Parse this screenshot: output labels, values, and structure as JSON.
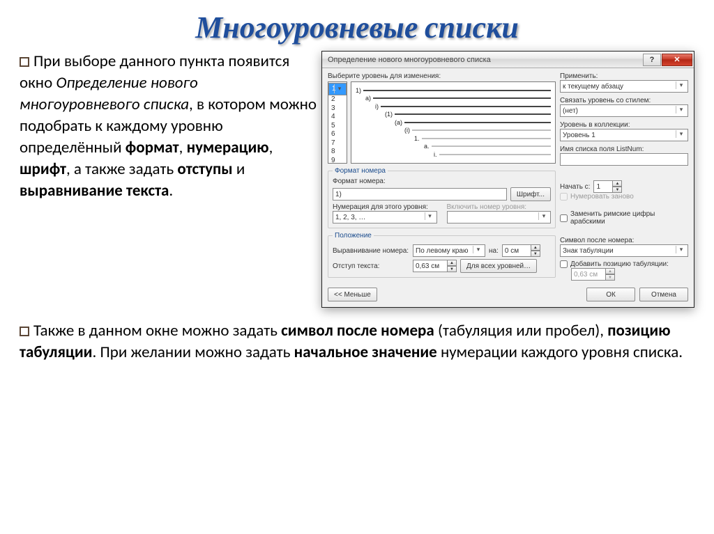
{
  "title": "Многоуровневые списки",
  "para1": {
    "p1": "При выборе данного пункта появится окно ",
    "i1": "Определение нового многоуровневого списка",
    "p2": ", в котором можно подобрать к каждому уровню определённый ",
    "b1": "формат",
    "c1": ", ",
    "b2": "нумерацию",
    "c2": ", ",
    "b3": "шрифт",
    "p3": ", а также задать ",
    "b4": "отступы",
    "p4": " и ",
    "b5": "выравнивание текста",
    "dot": "."
  },
  "para2": {
    "p1": "Также в данном окне можно задать ",
    "b1": "символ после номера",
    "p2": " (табуляция или пробел), ",
    "b2": "позицию табуляции",
    "p3": ". При желании можно  задать ",
    "b3": "начальное значение",
    "p4": " нумерации каждого уровня списка."
  },
  "dialog": {
    "title": "Определение нового многоуровневого списка",
    "select_level_label": "Выберите уровень для изменения:",
    "levels": [
      "1",
      "2",
      "3",
      "4",
      "5",
      "6",
      "7",
      "8",
      "9"
    ],
    "preview_numbers": [
      "1)",
      "a)",
      "i)",
      "(1)",
      "(a)",
      "(i)",
      "1.",
      "a.",
      "i."
    ],
    "format_group": "Формат номера",
    "format_label": "Формат номера:",
    "format_value": "1)",
    "font_btn": "Шрифт...",
    "numbering_label": "Нумерация для этого уровня:",
    "numbering_value": "1, 2, 3, …",
    "include_label": "Включить номер уровня:",
    "position_group": "Положение",
    "align_label": "Выравнивание номера:",
    "align_value": "По левому краю",
    "at_label": "на:",
    "at_value": "0 см",
    "indent_label": "Отступ текста:",
    "indent_value": "0,63 см",
    "all_levels_btn": "Для всех уровней…",
    "apply_label": "Применить:",
    "apply_value": "к текущему абзацу",
    "link_style_label": "Связать уровень со стилем:",
    "link_style_value": "(нет)",
    "collection_label": "Уровень в коллекции:",
    "collection_value": "Уровень 1",
    "listnum_label": "Имя списка поля ListNum:",
    "start_label": "Начать с:",
    "start_value": "1",
    "restart_label": "Нумеровать заново",
    "roman_label": "Заменить римские цифры арабскими",
    "symbol_label": "Символ после номера:",
    "symbol_value": "Знак табуляции",
    "addtab_label": "Добавить позицию табуляции:",
    "addtab_value": "0,63 см",
    "less_btn": "<< Меньше",
    "ok_btn": "ОК",
    "cancel_btn": "Отмена"
  }
}
